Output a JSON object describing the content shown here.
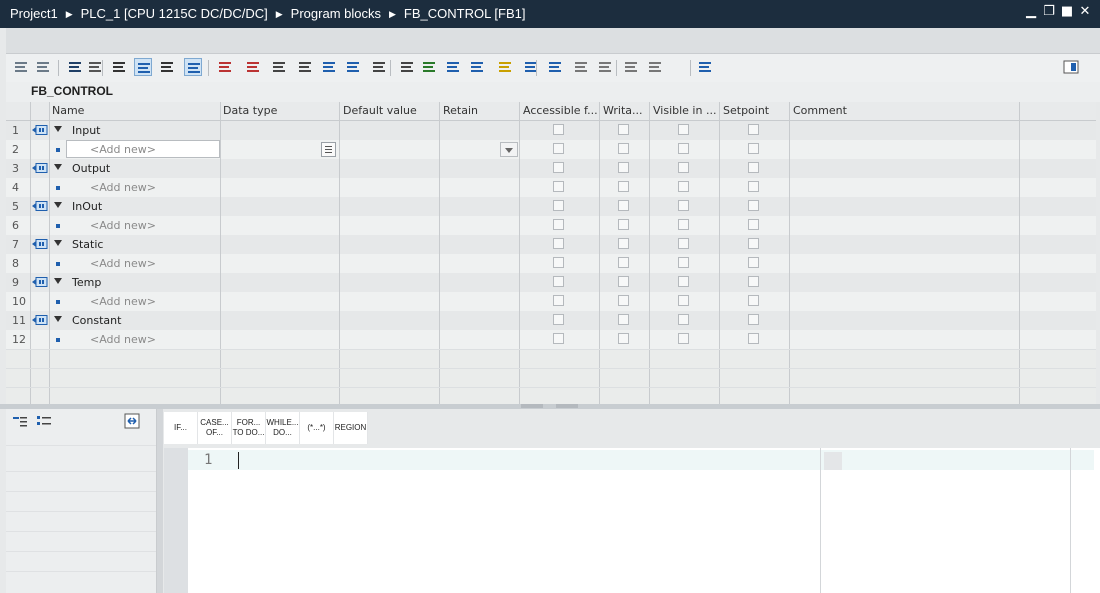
{
  "breadcrumb": {
    "items": [
      "Project1",
      "PLC_1 [CPU 1215C DC/DC/DC]",
      "Program blocks",
      "FB_CONTROL [FB1]"
    ],
    "separator": "▶"
  },
  "window_controls": {
    "minimize": "▁",
    "restore": "❐",
    "maximize": "■",
    "close": "✕"
  },
  "block": {
    "name": "FB_CONTROL"
  },
  "columns": [
    "Name",
    "Data type",
    "Default value",
    "Retain",
    "Accessible f...",
    "Writa...",
    "Visible in ...",
    "Setpoint",
    "Comment"
  ],
  "rows": [
    {
      "num": "1",
      "name": "Input",
      "type": "section"
    },
    {
      "num": "2",
      "name": "<Add new>",
      "type": "add",
      "editing": true
    },
    {
      "num": "3",
      "name": "Output",
      "type": "section"
    },
    {
      "num": "4",
      "name": "<Add new>",
      "type": "add"
    },
    {
      "num": "5",
      "name": "InOut",
      "type": "section"
    },
    {
      "num": "6",
      "name": "<Add new>",
      "type": "add"
    },
    {
      "num": "7",
      "name": "Static",
      "type": "section"
    },
    {
      "num": "8",
      "name": "<Add new>",
      "type": "add"
    },
    {
      "num": "9",
      "name": "Temp",
      "type": "section"
    },
    {
      "num": "10",
      "name": "<Add new>",
      "type": "add"
    },
    {
      "num": "11",
      "name": "Constant",
      "type": "section"
    },
    {
      "num": "12",
      "name": "<Add new>",
      "type": "add"
    }
  ],
  "scl_toolbar": [
    {
      "line1": "IF...",
      "line2": ""
    },
    {
      "line1": "CASE...",
      "line2": "OF..."
    },
    {
      "line1": "FOR...",
      "line2": "TO DO..."
    },
    {
      "line1": "WHILE...",
      "line2": "DO..."
    },
    {
      "line1": "(*...*)",
      "line2": ""
    },
    {
      "line1": "REGION",
      "line2": ""
    }
  ],
  "editor": {
    "line_number": "1"
  },
  "icons": {
    "toolbar": [
      "insert-row-icon",
      "add-row-icon",
      "download-icon",
      "monitor-icon",
      "indent-icon",
      "interface-view-icon",
      "snapshot-icon",
      "favorites-icon",
      "reset-start-icon",
      "reset-icon",
      "insert-block-icon",
      "call-block-icon",
      "indent-right-icon",
      "indent-left-icon",
      "outdent-icon",
      "comment-icon",
      "uncomment-icon",
      "line-numbers-icon",
      "absolute-operand-icon",
      "breakpoint-icon",
      "goto-icon",
      "jump-icon",
      "monitoring-icon",
      "watch-icon",
      "watch-all-icon",
      "trace-icon",
      "settings-panel-icon"
    ]
  }
}
